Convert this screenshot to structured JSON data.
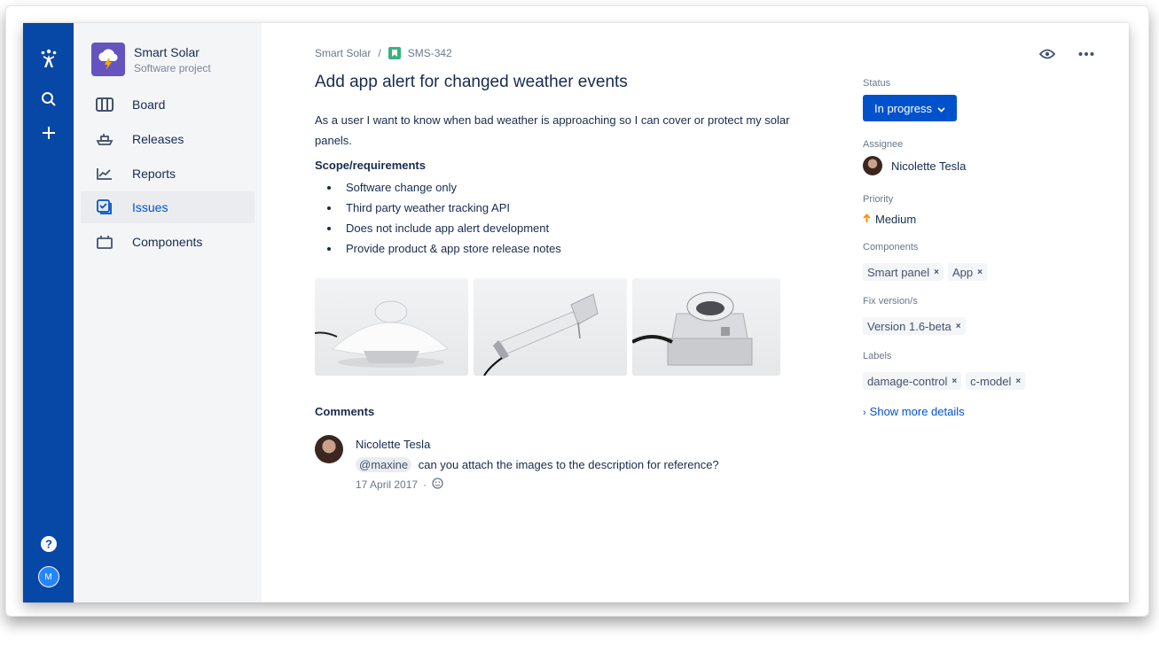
{
  "project": {
    "name": "Smart Solar",
    "type": "Software project"
  },
  "sidebar": {
    "items": [
      {
        "label": "Board",
        "icon": "board-icon"
      },
      {
        "label": "Releases",
        "icon": "ship-icon"
      },
      {
        "label": "Reports",
        "icon": "chart-icon"
      },
      {
        "label": "Issues",
        "icon": "issues-icon",
        "active": true
      },
      {
        "label": "Components",
        "icon": "components-icon"
      }
    ]
  },
  "breadcrumb": {
    "project": "Smart Solar",
    "separator": "/",
    "issue_key": "SMS-342"
  },
  "issue": {
    "title": "Add app alert for changed weather events",
    "description": "As a user I want to know when bad weather is approaching so I can cover or protect my solar panels.",
    "scope_heading": "Scope/requirements",
    "scope_items": [
      "Software change only",
      "Third party weather tracking API",
      "Does not include app alert development",
      "Provide product & app store release notes"
    ]
  },
  "comments": {
    "heading": "Comments",
    "items": [
      {
        "author": "Nicolette Tesla",
        "mention": "@maxine",
        "text": "can you attach the images to the description for reference?",
        "date": "17 April 2017",
        "dot": "·"
      }
    ]
  },
  "details": {
    "status_label": "Status",
    "status_value": "In progress",
    "assignee_label": "Assignee",
    "assignee_name": "Nicolette Tesla",
    "priority_label": "Priority",
    "priority_value": "Medium",
    "components_label": "Components",
    "components": [
      "Smart panel",
      "App"
    ],
    "fix_versions_label": "Fix version/s",
    "fix_versions": [
      "Version 1.6-beta"
    ],
    "labels_label": "Labels",
    "labels": [
      "damage-control",
      "c-model"
    ],
    "show_more": "Show more details",
    "remove_glyph": "×"
  },
  "global_nav": {
    "avatar_initial": "M"
  },
  "colors": {
    "nav": "#0747A6",
    "accent": "#0052CC",
    "sidebar": "#F4F5F7",
    "story": "#36B37E"
  }
}
